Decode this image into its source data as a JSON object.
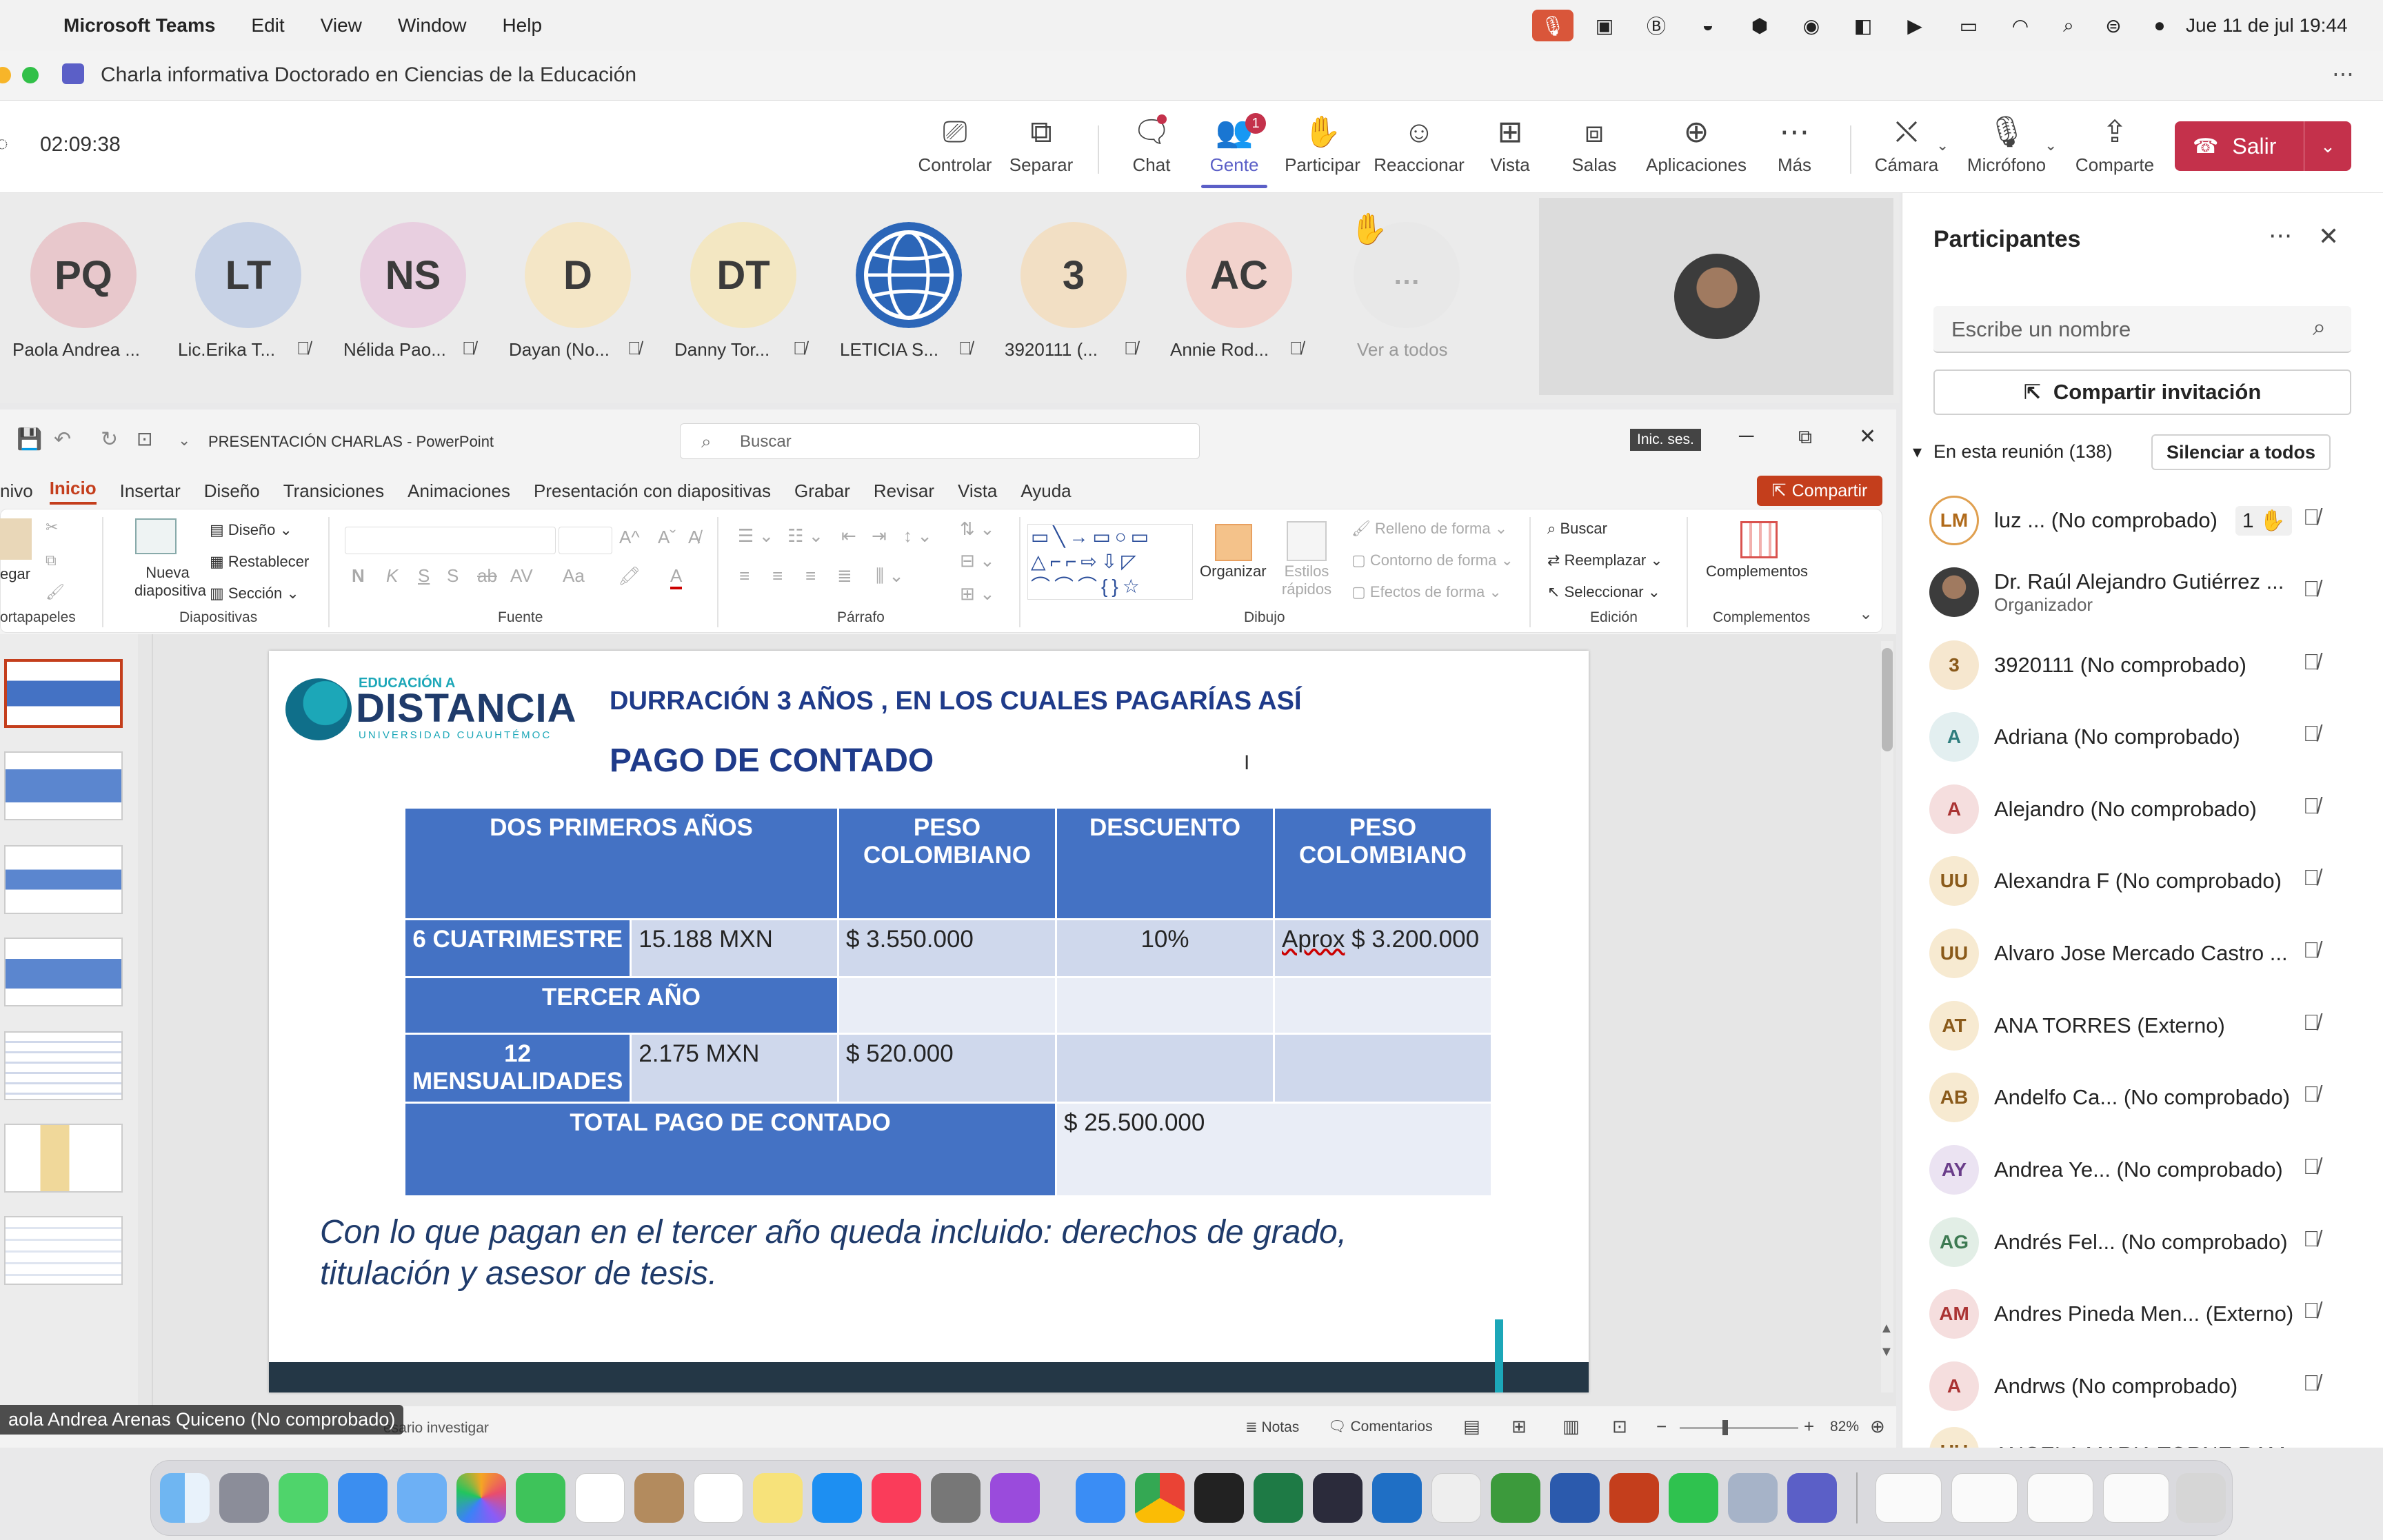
{
  "menubar": {
    "app": "Microsoft Teams",
    "items": [
      "Edit",
      "View",
      "Window",
      "Help"
    ],
    "clock": "Jue 11 de jul  19:44"
  },
  "window": {
    "title": "Charla informativa Doctorado en Ciencias de la Educación",
    "timer": "02:09:38"
  },
  "toolbar": {
    "items": [
      {
        "label": "Controlar",
        "icon": "control-icon"
      },
      {
        "label": "Separar",
        "icon": "popout-icon"
      },
      {
        "label": "Chat",
        "icon": "chat-icon"
      },
      {
        "label": "Gente",
        "icon": "people-icon",
        "badge": "1"
      },
      {
        "label": "Participar",
        "icon": "hand-icon"
      },
      {
        "label": "Reaccionar",
        "icon": "smile-icon"
      },
      {
        "label": "Vista",
        "icon": "grid-icon"
      },
      {
        "label": "Salas",
        "icon": "rooms-icon"
      },
      {
        "label": "Aplicaciones",
        "icon": "plus-icon"
      },
      {
        "label": "Más",
        "icon": "more-icon"
      }
    ],
    "camera": "Cámara",
    "mic": "Micrófono",
    "share": "Comparte",
    "leave": "Salir"
  },
  "strip": {
    "participants": [
      {
        "initials": "PQ",
        "name": "Paola Andrea ...",
        "color": "#e8c8cc"
      },
      {
        "initials": "LT",
        "name": "Lic.Erika T...",
        "color": "#c7d2e6"
      },
      {
        "initials": "NS",
        "name": "Nélida Pao...",
        "color": "#e8cfe0"
      },
      {
        "initials": "D",
        "name": "Dayan (No...",
        "color": "#f4e6c6"
      },
      {
        "initials": "DT",
        "name": "Danny Tor...",
        "color": "#f3e7c2"
      },
      {
        "initials": "",
        "name": "LETICIA S...",
        "color": "#2c66b8"
      },
      {
        "initials": "3",
        "name": "3920111 (...",
        "color": "#f2dfc4"
      },
      {
        "initials": "AC",
        "name": "Annie Rod...",
        "color": "#f2d3cd"
      }
    ],
    "see_all": "Ver a todos",
    "see_all_icon": "…"
  },
  "panel": {
    "title": "Participantes",
    "search_placeholder": "Escribe un nombre",
    "invite": "Compartir invitación",
    "section": "En esta reunión (138)",
    "mute_all": "Silenciar a todos",
    "rows": [
      {
        "initials": "LM",
        "name": "luz ... (No comprobado)",
        "bg": "#fff",
        "fg": "#b06a1a",
        "extra": "1 ✋"
      },
      {
        "initials": "",
        "name": "Dr. Raúl Alejandro Gutiérrez ...",
        "sub": "Organizador",
        "bg": "#555",
        "fg": "#fff"
      },
      {
        "initials": "3",
        "name": "3920111 (No comprobado)",
        "bg": "#f6e7cf",
        "fg": "#8a5a1a"
      },
      {
        "initials": "A",
        "name": "Adriana (No comprobado)",
        "bg": "#e3eff0",
        "fg": "#2e7d7d"
      },
      {
        "initials": "A",
        "name": "Alejandro (No comprobado)",
        "bg": "#f5dede",
        "fg": "#a33"
      },
      {
        "initials": "UU",
        "name": "Alexandra F (No comprobado)",
        "bg": "#f7ead1",
        "fg": "#8a5a1a"
      },
      {
        "initials": "UU",
        "name": "Alvaro Jose Mercado Castro ...",
        "bg": "#f7ead1",
        "fg": "#8a5a1a"
      },
      {
        "initials": "AT",
        "name": "ANA TORRES (Externo)",
        "bg": "#f7ead1",
        "fg": "#8a5a1a"
      },
      {
        "initials": "AB",
        "name": "Andelfo Ca... (No comprobado)",
        "bg": "#f7ead1",
        "fg": "#8a5a1a"
      },
      {
        "initials": "AY",
        "name": "Andrea Ye...  (No comprobado)",
        "bg": "#ebe3f2",
        "fg": "#6a3d8a"
      },
      {
        "initials": "AG",
        "name": "Andrés Fel... (No comprobado)",
        "bg": "#e2eee6",
        "fg": "#3d7a52"
      },
      {
        "initials": "AM",
        "name": "Andres Pineda Men... (Externo)",
        "bg": "#f5dede",
        "fg": "#a33"
      },
      {
        "initials": "A",
        "name": "Andrws (No comprobado)",
        "bg": "#f5dede",
        "fg": "#a33"
      },
      {
        "initials": "UU",
        "name": "ANGELA MARIA TORNE RAM...",
        "bg": "#f7ead1",
        "fg": "#8a5a1a"
      }
    ]
  },
  "ppt": {
    "title": "PRESENTACIÓN CHARLAS  -  PowerPoint",
    "search": "Buscar",
    "signin": "Inic. ses.",
    "tabs": [
      "nivo",
      "Inicio",
      "Insertar",
      "Diseño",
      "Transiciones",
      "Animaciones",
      "Presentación con diapositivas",
      "Grabar",
      "Revisar",
      "Vista",
      "Ayuda"
    ],
    "share": "Compartir",
    "ribbon": {
      "new_slide": "Nueva diapositiva",
      "design": "Diseño",
      "reset": "Restablecer",
      "section": "Sección",
      "groups": {
        "clipboard": "ortapapeles",
        "slides": "Diapositivas",
        "font": "Fuente",
        "paragraph": "Párrafo",
        "drawing": "Dibujo",
        "editing": "Edición",
        "addins": "Complementos"
      },
      "paste": "egar",
      "organize": "Organizar",
      "quick_styles": "Estilos rápidos",
      "fill": "Relleno de forma",
      "outline": "Contorno de forma",
      "effects": "Efectos de forma",
      "find": "Buscar",
      "replace": "Reemplazar",
      "select": "Seleccionar",
      "addins_btn": "Complementos"
    },
    "slide": {
      "logo_top": "EDUCACIÓN A",
      "logo_main": "DISTANCIA",
      "logo_sub": "UNIVERSIDAD CUAUHTÉMOC",
      "heading1": "DURRACIÓN 3 AÑOS , EN LOS CUALES PAGARÍAS ASÍ",
      "heading2": "PAGO DE CONTADO",
      "table": {
        "h1": "DOS PRIMEROS AÑOS",
        "h2": "PESO COLOMBIANO",
        "h3": "DESCUENTO",
        "h4": "PESO COLOMBIANO",
        "r1c1": "6 CUATRIMESTRE",
        "r1c2": "15.188 MXN",
        "r1c3": "$ 3.550.000",
        "r1c4": "10%",
        "r1c5a": "Aprox",
        "r1c5b": " $ 3.200.000",
        "r2": "TERCER AÑO",
        "r3c1": "12 MENSUALIDADES",
        "r3c2": "2.175 MXN",
        "r3c3": "$ 520.000",
        "r4c1": "TOTAL PAGO DE CONTADO",
        "r4c2": "$ 25.500.000"
      },
      "note": "Con lo que pagan en el tercer año queda incluido: derechos de grado, titulación y asesor de tesis."
    },
    "status": {
      "speaker": "aola Andrea Arenas Quiceno (No comprobado)",
      "hint": "esario investigar",
      "notes": "Notas",
      "comments": "Comentarios",
      "zoom": "82%"
    }
  },
  "colors": {
    "leave": "#c4314b",
    "teams_accent": "#5b5fc7",
    "slide_blue": "#4472c4",
    "ppt_red": "#c43e1c"
  }
}
